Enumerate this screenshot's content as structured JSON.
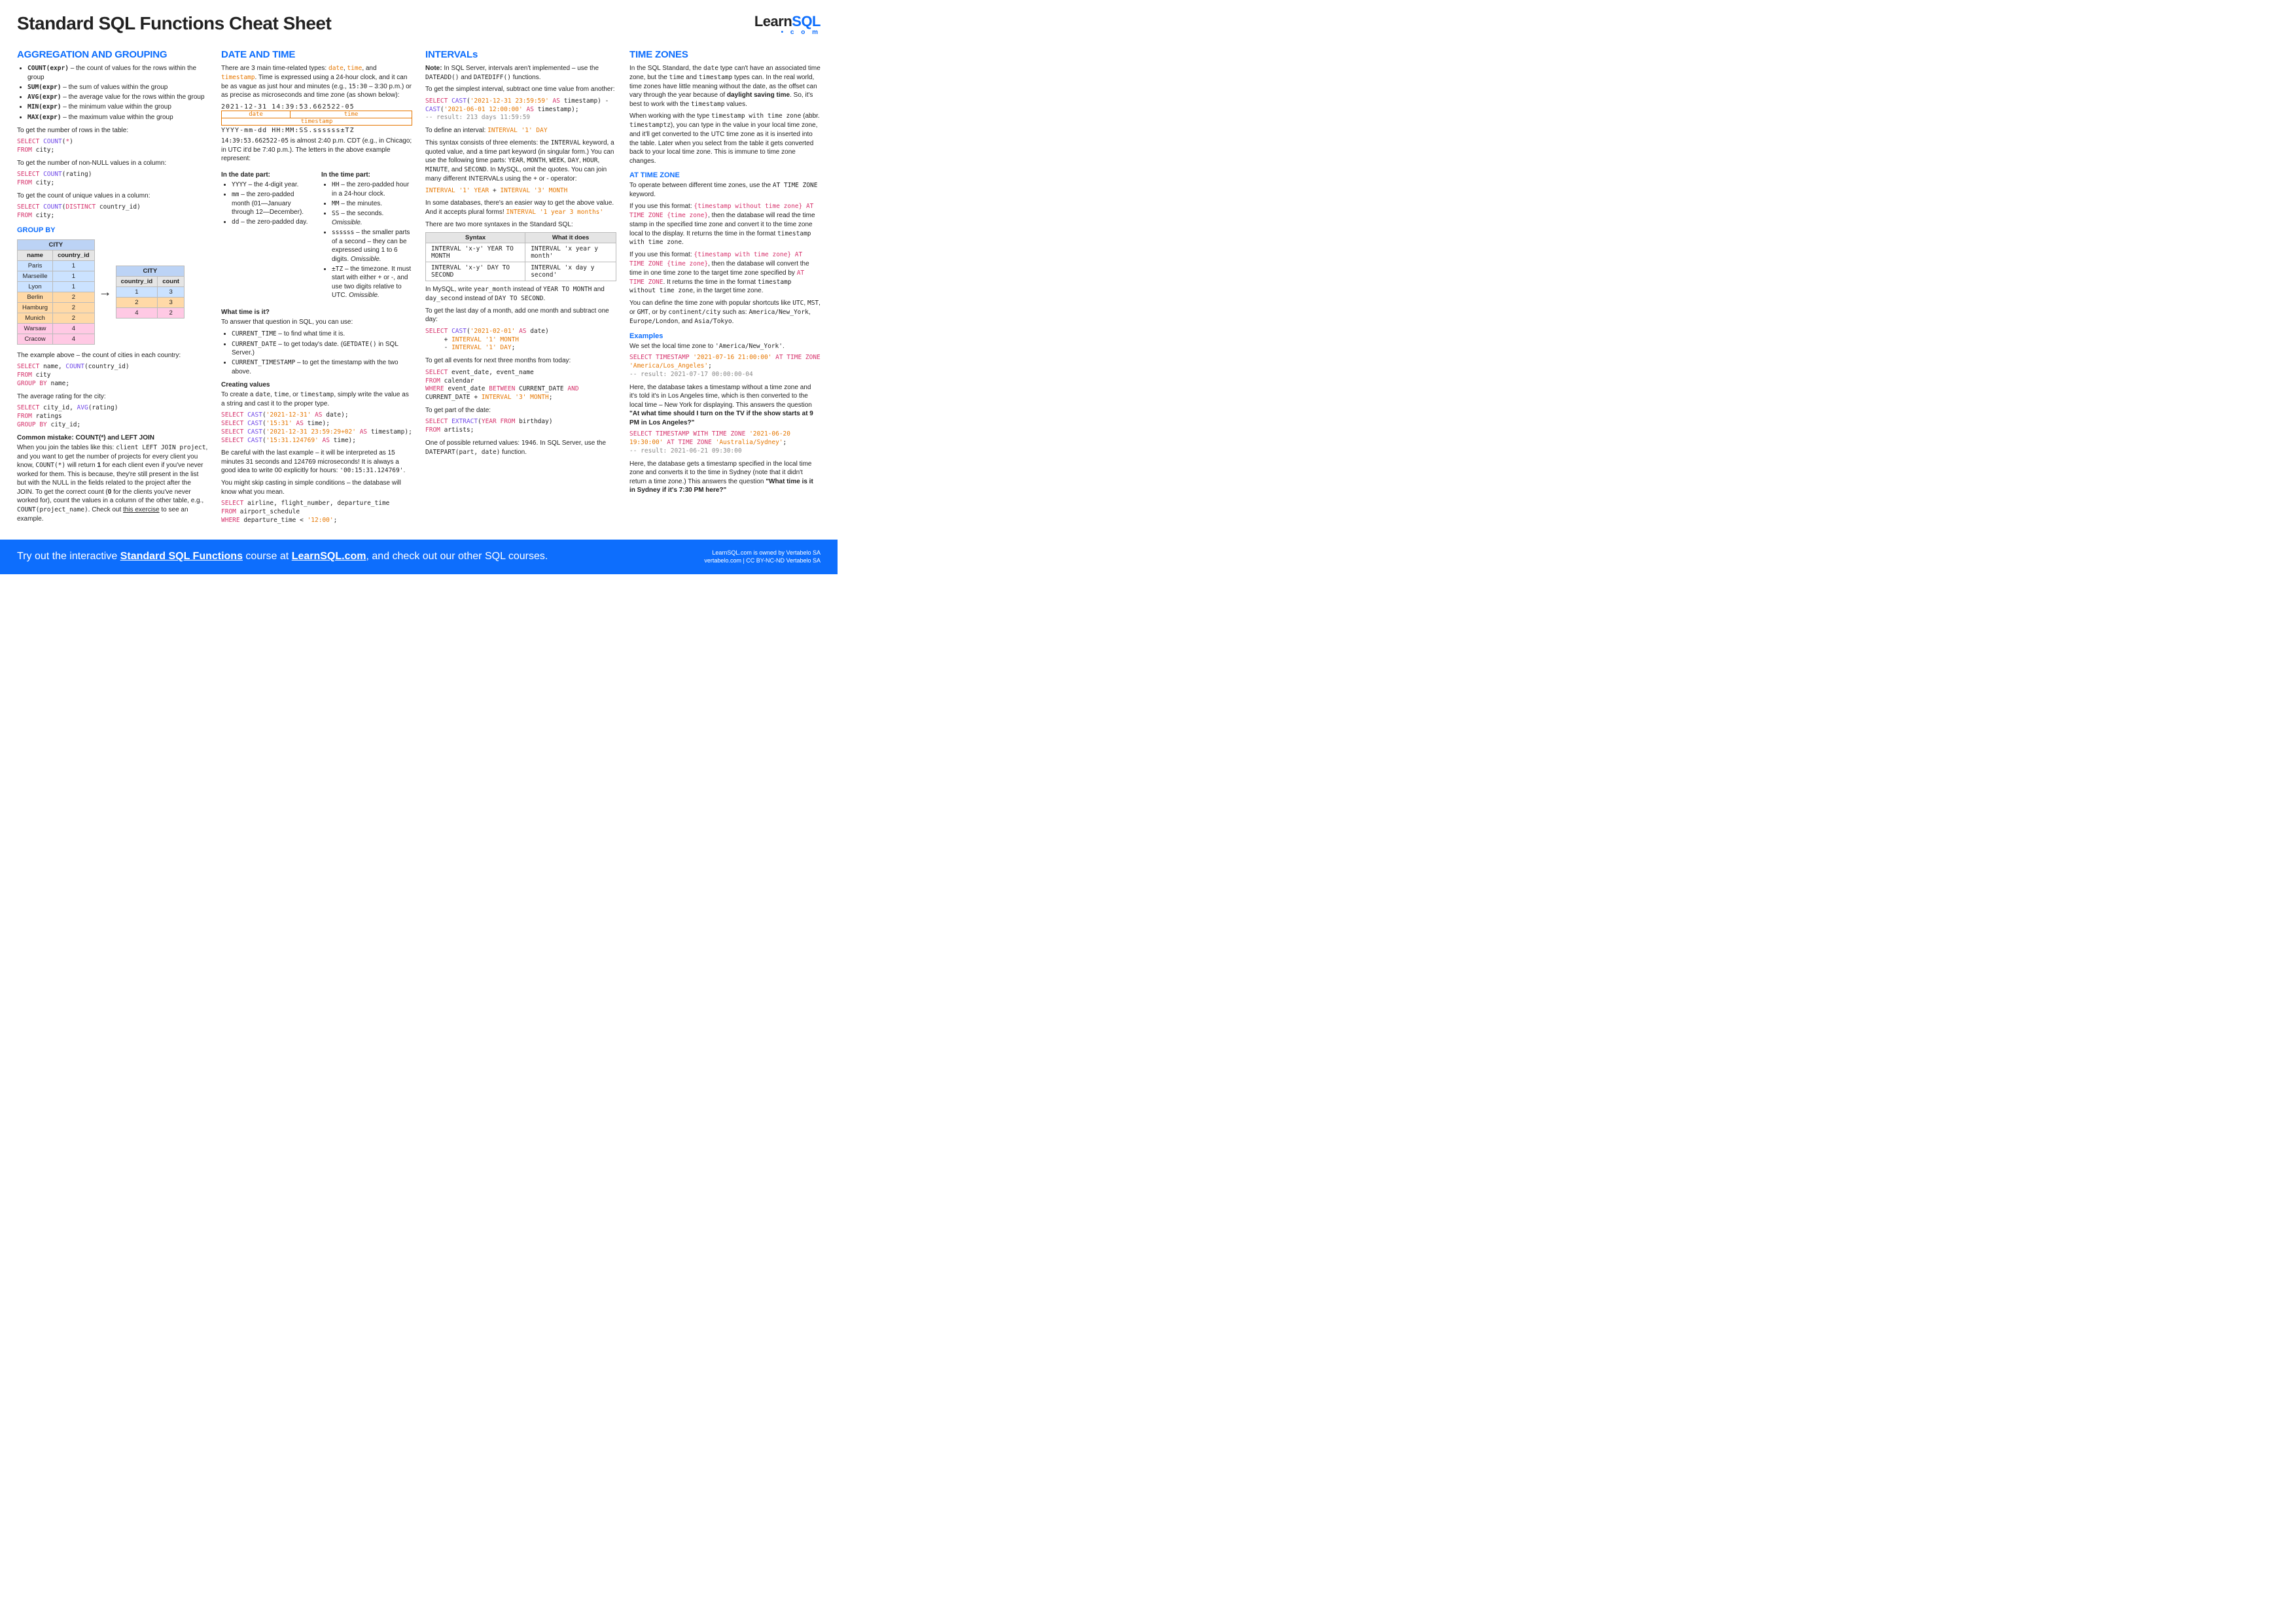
{
  "title": "Standard SQL Functions Cheat Sheet",
  "logo": {
    "learn": "Learn",
    "sql": "SQL",
    "sub": "• c o m"
  },
  "c1": {
    "h1": "AGGREGATION AND GROUPING",
    "fn1": "COUNT(expr)",
    "d1": " – the count of values for the rows within the group",
    "fn2": "SUM(expr)",
    "d2": " – the sum of values within the group",
    "fn3": "AVG(expr)",
    "d3": " – the average value for the rows within the group",
    "fn4": "MIN(expr)",
    "d4": " – the minimum value within the group",
    "fn5": "MAX(expr)",
    "d5": " – the maximum value within the group",
    "p1": "To get the number of rows in the table:",
    "p2": "To get the number of non-NULL values in a column:",
    "p3": "To get the count of unique values in a column:",
    "h2": "GROUP BY",
    "th_city": "CITY",
    "th_name": "name",
    "th_cid": "country_id",
    "th_count": "count",
    "rows": [
      [
        "Paris",
        "1"
      ],
      [
        "Marseille",
        "1"
      ],
      [
        "Lyon",
        "1"
      ],
      [
        "Berlin",
        "2"
      ],
      [
        "Hamburg",
        "2"
      ],
      [
        "Munich",
        "2"
      ],
      [
        "Warsaw",
        "4"
      ],
      [
        "Cracow",
        "4"
      ]
    ],
    "agg": [
      [
        "1",
        "3"
      ],
      [
        "2",
        "3"
      ],
      [
        "4",
        "2"
      ]
    ],
    "p4": "The example above – the count of cities in each country:",
    "p5": "The average rating for the city:",
    "h3": "Common mistake: COUNT(*) and LEFT JOIN",
    "p6a": "When you join the tables like this: ",
    "p6b": ", and you want to get the number of projects for every client you know, ",
    "p6c": " will return ",
    "p6d": "1",
    "p6e": " for each client even if you've never worked for them. This is because, they're still present in the list but with the NULL in the fields related to the project after the JOIN. To get the correct count (",
    "p6f": "0",
    "p6g": " for the clients you've never worked for), count the values in a column of the other table, e.g., ",
    "p6h": ". Check out ",
    "p6i": "this exercise",
    "p6j": " to see an example.",
    "code_ljoin": "client LEFT JOIN project",
    "code_countstar": "COUNT(*)",
    "code_countproj": "COUNT(project_name)"
  },
  "c2": {
    "h1": "DATE AND TIME",
    "p1a": "There are 3 main time-related types: ",
    "t_date": "date",
    "t_time": "time",
    "t_ts": "timestamp",
    "p1b": ". Time is expressed using a 24-hour clock, and it can be as vague as just hour and minutes (e.g., ",
    "p1c": "15:30",
    "p1d": " – 3:30 p.m.) or as precise as microseconds and time zone (as shown below):",
    "ts_top": "2021-12-31 14:39:53.662522-05",
    "ts_d": "date",
    "ts_t": "time",
    "ts_u": "timestamp",
    "ts_fmt": "YYYY-mm-dd HH:MM:SS.ssssss±TZ",
    "p2a": "14:39:53.662522-05",
    "p2b": " is almost 2:40 p.m. CDT (e.g., in Chicago; in UTC it'd be 7:40 p.m.). The letters in the above example represent:",
    "hdp": "In the date part:",
    "htp": "In the time part:",
    "dp1a": "YYYY",
    "dp1b": " – the 4-digit year.",
    "dp2a": "mm",
    "dp2b": " – the zero-padded month (01—January through 12—December).",
    "dp3a": "dd",
    "dp3b": " – the zero-padded day.",
    "tp1a": "HH",
    "tp1b": " – the zero-padded hour in a 24-hour clock.",
    "tp2a": "MM",
    "tp2b": " – the minutes.",
    "tp3a": "SS",
    "tp3b": " – the seconds. ",
    "om": "Omissible.",
    "tp4a": "ssssss",
    "tp4b": " – the smaller parts of a second – they can be expressed using 1 to 6 digits. ",
    "tp5a": "±TZ",
    "tp5b": " – the timezone. It must start with either + or -, and use two digits relative to UTC. ",
    "h2": "What time is it?",
    "p3": "To answer that question in SQL, you can use:",
    "li1a": "CURRENT_TIME",
    "li1b": " – to find what time it is.",
    "li2a": "CURRENT_DATE",
    "li2b": " – to get today's date. (",
    "li2c": "GETDATE()",
    "li2d": " in SQL Server.)",
    "li3a": "CURRENT_TIMESTAMP",
    "li3b": " – to get the timestamp with the two above.",
    "h3": "Creating values",
    "p4a": "To create a ",
    "p4b": ", simply write the value as a string and cast it to the proper type.",
    "p5": "Be careful with the last example – it will be interpreted as 15 minutes 31 seconds and 124769 microseconds! It is always a good idea to write 00 explicitly for hours: ",
    "p5c": "'00:15:31.124769'",
    "p6": "You might skip casting in simple conditions – the database will know what you mean."
  },
  "c3": {
    "h1": "INTERVALs",
    "p1a": "Note:",
    "p1b": " In SQL Server, intervals aren't implemented – use the ",
    "p1c": "DATEADD()",
    "p1d": " and ",
    "p1e": "DATEDIFF()",
    "p1f": " functions.",
    "p2": "To get the simplest interval, subtract one time value from another:",
    "p3a": "To define an interval: ",
    "p3b": "INTERVAL '1' DAY",
    "p4a": "This syntax consists of three elements: the ",
    "p4b": "INTERVAL",
    "p4c": " keyword, a quoted value, and a time part keyword (in singular form.) You can use the following time parts: ",
    "p4d": "YEAR",
    "p4e": ", ",
    "p4f": "MONTH",
    "p4g": "WEEK",
    "p4h": "DAY",
    "p4i": "HOUR",
    "p4j": "MINUTE",
    "p4k": "SECOND",
    "p4l": ". In MySQL, omit the quotes. You can join many different INTERVALs using the + or - operator:",
    "p5a": "In some databases, there's an easier way to get the above value. And it accepts plural forms! ",
    "p5b": "INTERVAL '1 year 3 months'",
    "p6": "There are two more syntaxes in the Standard SQL:",
    "th_syn": "Syntax",
    "th_what": "What it does",
    "syn1a": "INTERVAL 'x-y' YEAR TO MONTH",
    "syn1b": "INTERVAL 'x year y month'",
    "syn2a": "INTERVAL 'x-y' DAY TO SECOND",
    "syn2b": "INTERVAL 'x day y second'",
    "p7a": "In MySQL, write ",
    "p7b": "year_month",
    "p7c": " instead of ",
    "p7d": "YEAR TO MONTH",
    "p7e": " and ",
    "p7f": "day_second",
    "p7g": " instead of ",
    "p7h": "DAY TO SECOND",
    "p8": "To get the last day of a month, add one month and subtract one day:",
    "p9": "To get all events for next three months from today:",
    "p10": "To get part of the date:",
    "p11a": "One of possible returned values: ",
    "p11b": "1946",
    "p11c": ". In SQL Server, use the ",
    "p11d": "DATEPART(part, date)",
    "p11e": " function."
  },
  "c4": {
    "h1": "TIME ZONES",
    "p1a": "In the SQL Standard, the ",
    "p1b": "date",
    "p1c": " type can't have an associated time zone, but the ",
    "p1d": "time",
    "p1e": " and ",
    "p1f": "timestamp",
    "p1g": " types can. In the real world, time zones have little meaning without the date, as the offset can vary through the year because of ",
    "p1h": "daylight saving time",
    "p1i": ". So, it's best to work with the ",
    "p1j": "timestamp",
    "p1k": " values.",
    "p2a": "When working with the type ",
    "p2b": "timestamp with time zone",
    "p2c": " (abbr. ",
    "p2d": "timestamptz",
    "p2e": "), you can type in the value in your local time zone, and it'll get converted to the UTC time zone as it is inserted into the table. Later when you select from the table it gets converted back to your local time zone. This is immune to time zone changes.",
    "h2": "AT TIME ZONE",
    "p3a": "To operate between different time zones, use the ",
    "p3b": "AT TIME ZONE",
    "p3c": " keyword.",
    "p4a": "If you use this format: ",
    "p4b": "{timestamp without time zone} AT TIME ZONE {time zone}",
    "p4c": ", then the database will read the time stamp in the specified time zone and convert it to the time zone local to the display. It returns the time in the format ",
    "p4d": "timestamp with time zone",
    "p5a": "If you use this format: ",
    "p5b": "{timestamp with time zone} AT TIME ZONE {time zone}",
    "p5c": ", then the database will convert the time in one time zone to the target time zone specified by ",
    "p5d": "AT TIME ZONE",
    "p5e": ". It returns the time in the format ",
    "p5f": "timestamp without time zone",
    "p5g": ", in the target time zone.",
    "p6a": "You can define the time zone with popular shortcuts like ",
    "p6b": "UTC",
    "p6c": "MST",
    "p6d": "GMT",
    "p6e": ", or by ",
    "p6f": "continent/city",
    "p6g": " such as: ",
    "p6h": "America/New_York",
    "p6i": "Europe/London",
    "p6j": "Asia/Tokyo",
    "h3": "Examples",
    "p7a": "We set the local time zone to ",
    "p7b": "'America/New_York'",
    "p8a": "Here, the database takes a timestamp without a time zone and it's told it's in Los Angeles time, which is then converted to the local time – New York for displaying. This answers the question ",
    "p8b": "\"At what time should I turn on the TV if the show starts at 9 PM in Los Angeles?\"",
    "p9a": "Here, the database gets a timestamp specified in the local time zone and converts it to the time in Sydney (note that it didn't return a time zone.) This answers the question ",
    "p9b": "\"What time is it in Sydney if it's 7:30 PM here?\""
  },
  "footer": {
    "left_a": "Try out the interactive ",
    "link1": "Standard SQL Functions",
    "left_b": " course at ",
    "link2": "LearnSQL.com",
    "left_c": ", and check out our other SQL courses.",
    "r1": "LearnSQL.com is owned by Vertabelo SA",
    "r2": "vertabelo.com | CC BY-NC-ND Vertabelo SA"
  }
}
